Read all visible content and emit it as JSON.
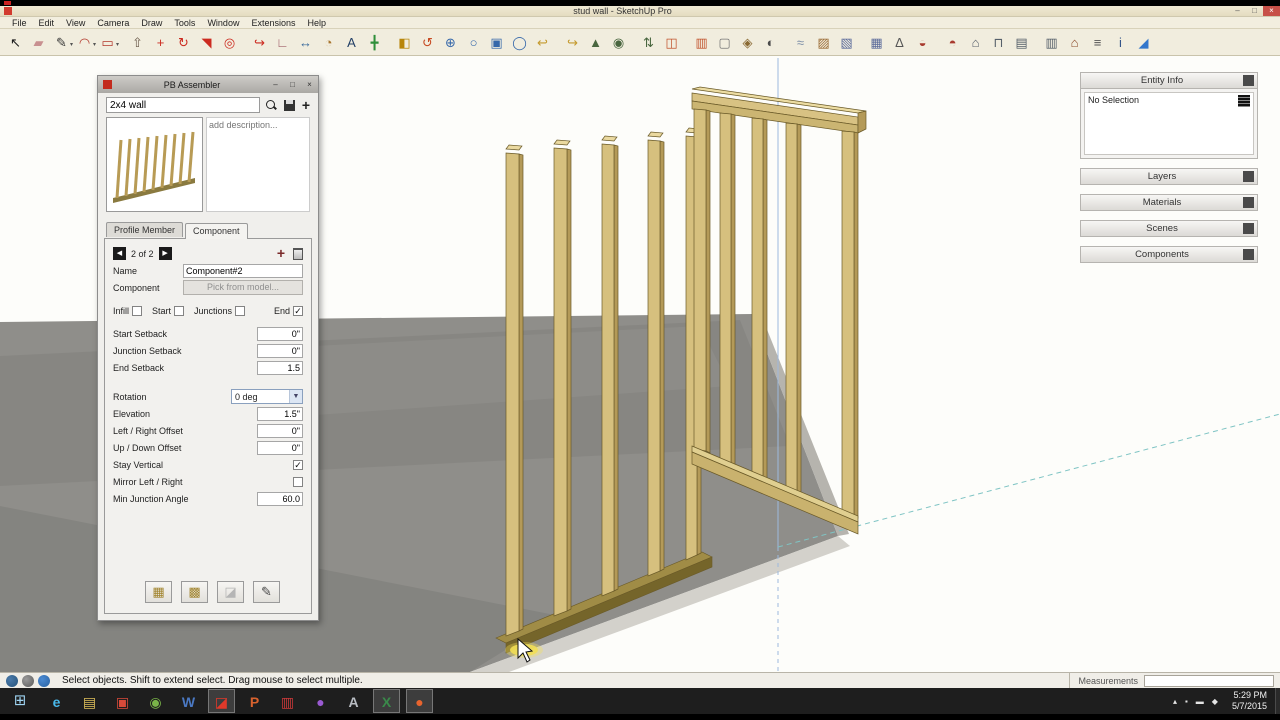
{
  "window": {
    "title": "stud wall - SketchUp Pro"
  },
  "glyphs": {
    "check": "✓",
    "caret": "▼",
    "caret_small": "▾",
    "prev": "◀",
    "next": "▶",
    "plus": "+",
    "minimize": "–",
    "maximize": "□",
    "close": "×",
    "start": "⊞"
  },
  "menu": {
    "items": [
      "File",
      "Edit",
      "View",
      "Camera",
      "Draw",
      "Tools",
      "Window",
      "Extensions",
      "Help"
    ]
  },
  "toolbar": {
    "icons": [
      {
        "name": "select-tool",
        "glyph": "↖",
        "color": "#1a1a1a"
      },
      {
        "name": "eraser-tool",
        "glyph": "▰",
        "color": "#c89090"
      },
      {
        "name": "line-tool",
        "glyph": "✎",
        "color": "#333333",
        "caret": true
      },
      {
        "name": "arc-tool",
        "glyph": "◠",
        "color": "#b33a2e",
        "caret": true
      },
      {
        "name": "shape-tool",
        "glyph": "▭",
        "color": "#b33a2e",
        "caret": true
      },
      {
        "name": "push-pull-tool",
        "glyph": "⇧",
        "color": "#6b5b4b",
        "sep": true
      },
      {
        "name": "move-tool",
        "glyph": "+",
        "color": "#cc2b20"
      },
      {
        "name": "rotate-tool",
        "glyph": "↻",
        "color": "#cc2b20"
      },
      {
        "name": "scale-tool",
        "glyph": "◥",
        "color": "#cc2b20"
      },
      {
        "name": "offset-tool",
        "glyph": "◎",
        "color": "#cc2b20"
      },
      {
        "name": "follow-me-tool",
        "glyph": "↪",
        "color": "#cc2b20",
        "sep": true
      },
      {
        "name": "tape-measure-tool",
        "glyph": "∟",
        "color": "#a0606a"
      },
      {
        "name": "dimension-tool",
        "glyph": "↔",
        "color": "#35679a"
      },
      {
        "name": "protractor-tool",
        "glyph": "◔",
        "color": "#a8762f"
      },
      {
        "name": "text-tool",
        "glyph": "A",
        "color": "#223f66"
      },
      {
        "name": "axes-tool",
        "glyph": "╋",
        "color": "#2f8f3a"
      },
      {
        "name": "paint-bucket-tool",
        "glyph": "◧",
        "color": "#b8860b",
        "sep": true
      },
      {
        "name": "orbit-tool",
        "glyph": "↺",
        "color": "#c74a22"
      },
      {
        "name": "pan-tool",
        "glyph": "⊕",
        "color": "#3668aa"
      },
      {
        "name": "zoom-tool",
        "glyph": "○",
        "color": "#3668aa"
      },
      {
        "name": "zoom-window-tool",
        "glyph": "▣",
        "color": "#3668aa"
      },
      {
        "name": "zoom-extents-tool",
        "glyph": "◯",
        "color": "#3668aa"
      },
      {
        "name": "previous-view",
        "glyph": "↩",
        "color": "#c49a2e"
      },
      {
        "name": "next-view",
        "glyph": "↪",
        "color": "#c49a2e",
        "sep": true
      },
      {
        "name": "position-camera-tool",
        "glyph": "▲",
        "color": "#49663f"
      },
      {
        "name": "look-around-tool",
        "glyph": "◉",
        "color": "#49663f"
      },
      {
        "name": "walk-tool",
        "glyph": "⇅",
        "color": "#49663f",
        "sep": true
      },
      {
        "name": "section-plane-tool",
        "glyph": "◫",
        "color": "#c2552e"
      },
      {
        "name": "section-fill-toggle",
        "glyph": "▥",
        "color": "#c2552e",
        "sep": true
      },
      {
        "name": "hide-rest-toggle",
        "glyph": "▢",
        "color": "#777777"
      },
      {
        "name": "component-browser",
        "glyph": "◈",
        "color": "#8a6a33"
      },
      {
        "name": "shadows-toggle",
        "glyph": "◐",
        "color": "#4a4a4a"
      },
      {
        "name": "fog-toggle",
        "glyph": "≈",
        "color": "#7d8fa8",
        "sep": true
      },
      {
        "name": "materials-browser",
        "glyph": "▨",
        "color": "#9a6a33"
      },
      {
        "name": "styles-browser",
        "glyph": "▧",
        "color": "#5a6a9a"
      },
      {
        "name": "match-photo",
        "glyph": "▦",
        "color": "#5a6a9a",
        "sep": true
      },
      {
        "name": "measure-angle-tool",
        "glyph": "∆",
        "color": "#555555"
      },
      {
        "name": "solid-union-tool",
        "glyph": "◒",
        "color": "#a83a2e"
      },
      {
        "name": "solid-subtract-tool",
        "glyph": "◓",
        "color": "#a83a2e",
        "sep": true
      },
      {
        "name": "iso-view",
        "glyph": "⌂",
        "color": "#56606a"
      },
      {
        "name": "top-view",
        "glyph": "⊓",
        "color": "#56606a"
      },
      {
        "name": "front-view",
        "glyph": "▤",
        "color": "#56606a"
      },
      {
        "name": "side-view",
        "glyph": "▥",
        "color": "#56606a",
        "sep": true
      },
      {
        "name": "warehouse",
        "glyph": "⌂",
        "color": "#8a4a2a"
      },
      {
        "name": "layers-manager",
        "glyph": "≡",
        "color": "#555555"
      },
      {
        "name": "model-info",
        "glyph": "i",
        "color": "#33558a"
      },
      {
        "name": "chart-report",
        "glyph": "◢",
        "color": "#3377cc"
      }
    ]
  },
  "assembler": {
    "title": "PB Assembler",
    "search": {
      "value": "2x4 wall"
    },
    "description_placeholder": "add description...",
    "tabs": {
      "profile": "Profile Member",
      "component": "Component"
    },
    "pager": {
      "text": "2 of 2"
    },
    "fields": {
      "name": {
        "label": "Name",
        "value": "Component#2"
      },
      "component": {
        "label": "Component",
        "button": "Pick from model..."
      },
      "checks": {
        "infill": "Infill",
        "start": "Start",
        "junctions": "Junctions",
        "end": "End"
      },
      "start_setback": {
        "label": "Start Setback",
        "value": "0\""
      },
      "junction_setback": {
        "label": "Junction Setback",
        "value": "0\""
      },
      "end_setback": {
        "label": "End Setback",
        "value": "1.5"
      },
      "rotation": {
        "label": "Rotation",
        "value": "0 deg"
      },
      "elevation": {
        "label": "Elevation",
        "value": "1.5\""
      },
      "lr_offset": {
        "label": "Left / Right Offset",
        "value": "0\""
      },
      "ud_offset": {
        "label": "Up / Down Offset",
        "value": "0\""
      },
      "stay_vertical": {
        "label": "Stay Vertical"
      },
      "mirror": {
        "label": "Mirror Left / Right"
      },
      "min_junction_angle": {
        "label": "Min Junction Angle",
        "value": "60.0"
      }
    },
    "check_states": {
      "infill": false,
      "start": false,
      "junctions": false,
      "end": true,
      "stay_vertical": true,
      "mirror": false
    },
    "buttons": [
      {
        "glyph": "▦"
      },
      {
        "glyph": "▩"
      },
      {
        "glyph": "◪"
      },
      {
        "glyph": "✎"
      }
    ]
  },
  "tray": {
    "panels": [
      {
        "label": "Entity Info",
        "body": "No Selection"
      },
      {
        "label": "Layers"
      },
      {
        "label": "Materials"
      },
      {
        "label": "Scenes"
      },
      {
        "label": "Components"
      }
    ]
  },
  "status": {
    "message": "Select objects. Shift to extend select. Drag mouse to select multiple.",
    "measurements_label": "Measurements"
  },
  "taskbar": {
    "apps": [
      {
        "name": "taskbar-ie",
        "glyph": "e",
        "color": "#49b8ea"
      },
      {
        "name": "taskbar-explorer",
        "glyph": "▤",
        "color": "#dfc05a"
      },
      {
        "name": "taskbar-media-app",
        "glyph": "▣",
        "color": "#d84a3a"
      },
      {
        "name": "taskbar-chrome",
        "glyph": "◉",
        "color": "#7ab648"
      },
      {
        "name": "taskbar-word",
        "glyph": "W",
        "color": "#4a78c2"
      },
      {
        "name": "taskbar-sketchup",
        "glyph": "◪",
        "color": "#e0392a",
        "active": true
      },
      {
        "name": "taskbar-powerpoint",
        "glyph": "P",
        "color": "#d8622e"
      },
      {
        "name": "taskbar-app-red",
        "glyph": "▥",
        "color": "#cc3a3a"
      },
      {
        "name": "taskbar-app-purple",
        "glyph": "●",
        "color": "#9a5ad2"
      },
      {
        "name": "taskbar-app-gray",
        "glyph": "A",
        "color": "#b8bcc2"
      },
      {
        "name": "taskbar-excel",
        "glyph": "X",
        "color": "#3a8a4a",
        "active": true
      },
      {
        "name": "taskbar-app-orange",
        "glyph": "●",
        "color": "#e8642e",
        "active": true
      }
    ],
    "tray_icons": [
      {
        "name": "tray-expand",
        "glyph": "▴"
      },
      {
        "name": "tray-action-center",
        "glyph": "▪"
      },
      {
        "name": "tray-network",
        "glyph": "▬"
      },
      {
        "name": "tray-volume",
        "glyph": "◆"
      }
    ],
    "time": "5:29 PM",
    "date": "5/7/2015"
  }
}
